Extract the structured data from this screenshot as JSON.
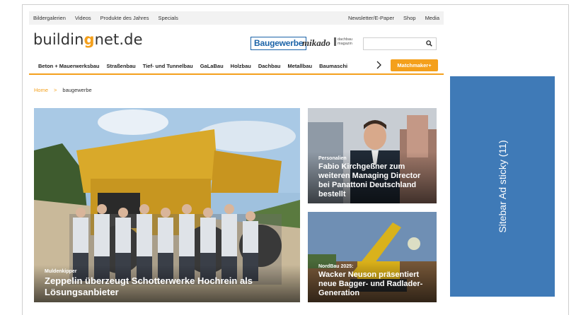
{
  "topbar": {
    "left": [
      "Bildergalerien",
      "Videos",
      "Produkte des Jahres",
      "Specials"
    ],
    "right": [
      "Newsletter/E-Paper",
      "Shop",
      "Media"
    ]
  },
  "logo": {
    "part1": "buildin",
    "dot": "g",
    "part2": "net.de"
  },
  "brands": {
    "baugewerbe": "Baugewerbe",
    "mikado": "mikado",
    "dachbau_line1": "dachbau",
    "dachbau_line2": "magazin"
  },
  "search": {
    "placeholder": "",
    "icon": "search-icon"
  },
  "nav": {
    "items": [
      "Beton + Mauerwerksbau",
      "Straßenbau",
      "Tief- und Tunnelbau",
      "GaLaBau",
      "Holzbau",
      "Dachbau",
      "Metallbau",
      "Baumaschi"
    ],
    "cta": "Matchmaker+"
  },
  "breadcrumb": {
    "home": "Home",
    "current": "baugewerbe"
  },
  "tiles": {
    "big": {
      "kicker": "Muldenkipper",
      "headline": "Zeppelin überzeugt Schotterwerke Hochrein als Lösungsanbieter"
    },
    "top_right": {
      "kicker": "Personalien",
      "headline": "Fabio Kirchgeßner zum weiteren Managing Director bei Panattoni Deutschland bestellt"
    },
    "bottom_right": {
      "kicker": "NordBau 2025:",
      "headline": "Wacker Neuson präsentiert neue Bagger- und Radlader-Generation"
    }
  },
  "ad": {
    "label": "Sitebar Ad sticky (11)"
  },
  "colors": {
    "accent": "#f4a01c",
    "brand_blue": "#1b63a8",
    "ad_blue": "#3f7ab7"
  }
}
